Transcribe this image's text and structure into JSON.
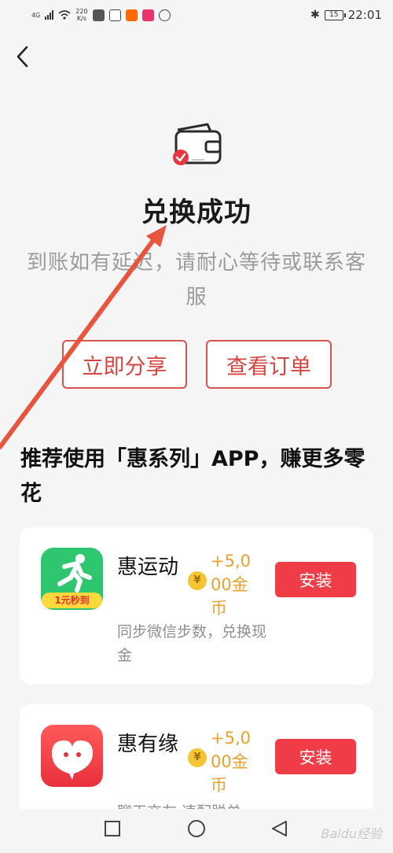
{
  "status_bar": {
    "network": "4G",
    "speed_value": "220",
    "speed_unit": "K/s",
    "battery": "15",
    "time": "22:01"
  },
  "header": {
    "back_icon": "chevron-left-icon"
  },
  "result": {
    "title": "兑换成功",
    "description": "到账如有延迟，请耐心等待或联系客服"
  },
  "actions": {
    "share_label": "立即分享",
    "order_label": "查看订单"
  },
  "recommend": {
    "title": "推荐使用「惠系列」APP，赚更多零花",
    "apps": [
      {
        "name": "惠运动",
        "icon_badge": "1元秒到",
        "coin_symbol": "¥",
        "reward": "+5,000金币",
        "install_label": "安装",
        "description": "同步微信步数，兑换现金"
      },
      {
        "name": "惠有缘",
        "coin_symbol": "¥",
        "reward": "+5,000金币",
        "install_label": "安装",
        "description": "聊天交友 速配脱单"
      }
    ]
  },
  "colors": {
    "accent": "#ef3c47",
    "outline": "#d9534f",
    "reward": "#e9a02c",
    "annotation_arrow": "#e8553f"
  },
  "watermark": "Baidu经验"
}
